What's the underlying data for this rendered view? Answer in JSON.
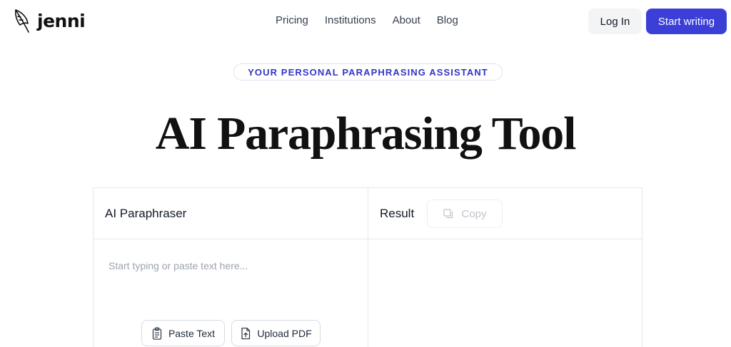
{
  "header": {
    "logo_text": "jenni",
    "nav": [
      "Pricing",
      "Institutions",
      "About",
      "Blog"
    ],
    "login_label": "Log In",
    "start_label": "Start writing"
  },
  "hero": {
    "badge": "YOUR PERSONAL PARAPHRASING ASSISTANT",
    "title": "AI Paraphrasing Tool"
  },
  "tool": {
    "input_title": "AI Paraphraser",
    "input_placeholder": "Start typing or paste text here...",
    "paste_label": "Paste Text",
    "upload_label": "Upload PDF",
    "result_title": "Result",
    "copy_label": "Copy"
  },
  "colors": {
    "brand": "#3b3fd8",
    "badge_text": "#3136c7"
  }
}
